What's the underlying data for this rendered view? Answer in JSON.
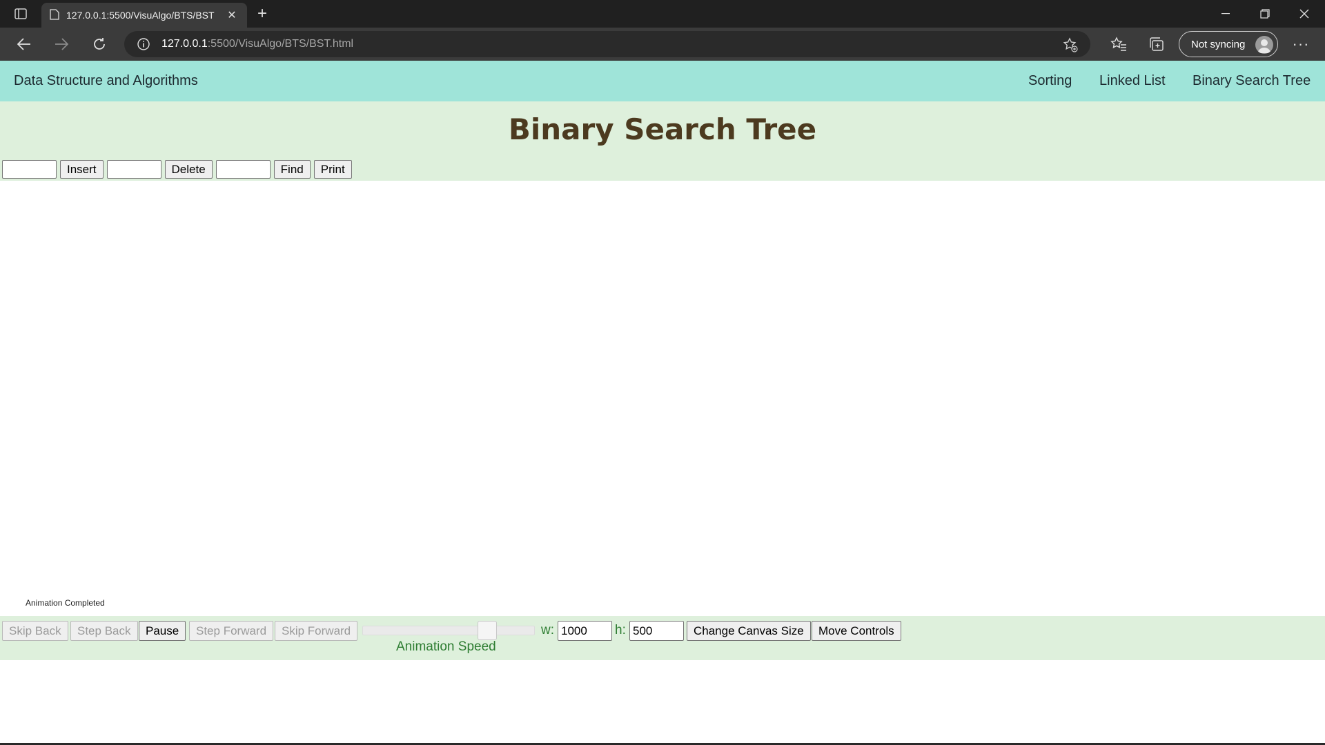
{
  "browser": {
    "tab_title": "127.0.0.1:5500/VisuAlgo/BTS/BST",
    "url_host": "127.0.0.1",
    "url_rest": ":5500/VisuAlgo/BTS/BST.html",
    "sync_label": "Not syncing"
  },
  "nav": {
    "brand": "Data Structure and Algorithms",
    "links": [
      "Sorting",
      "Linked List",
      "Binary Search Tree"
    ]
  },
  "page": {
    "title": "Binary Search Tree"
  },
  "controls": {
    "insert_label": "Insert",
    "delete_label": "Delete",
    "find_label": "Find",
    "print_label": "Print"
  },
  "status": {
    "animation": "Animation Completed"
  },
  "bottom": {
    "skip_back": "Skip Back",
    "step_back": "Step Back",
    "pause": "Pause",
    "step_forward": "Step Forward",
    "skip_forward": "Skip Forward",
    "speed_label": "Animation Speed",
    "speed_fraction": 0.75,
    "w_label": "w:",
    "w_value": "1000",
    "h_label": "h:",
    "h_value": "500",
    "change_canvas": "Change Canvas Size",
    "move_controls": "Move Controls"
  }
}
